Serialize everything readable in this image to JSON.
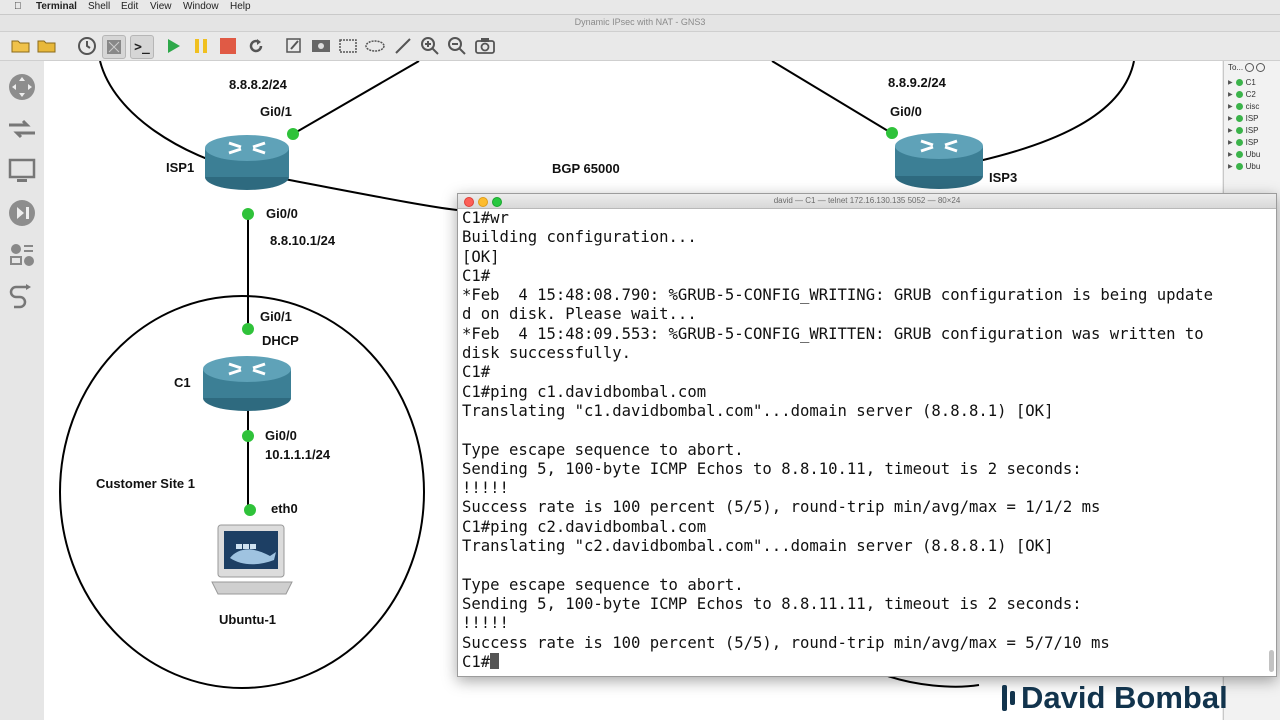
{
  "menubar": {
    "items": [
      "Terminal",
      "Shell",
      "Edit",
      "View",
      "Window",
      "Help"
    ]
  },
  "window": {
    "title": "Dynamic IPsec with NAT - GNS3"
  },
  "toolbar": {
    "icons": [
      "open-folder-icon",
      "folder-icon",
      "clock-icon",
      "snapshot-icon",
      "console-icon",
      "play-icon",
      "pause-icon",
      "stop-icon",
      "reload-icon",
      "note-icon",
      "image-icon",
      "rectangle-icon",
      "ellipse-icon",
      "line-icon",
      "zoom-in-icon",
      "zoom-out-icon",
      "camera-icon"
    ]
  },
  "topology": {
    "labels": {
      "isp1_top_ip": "8.8.8.2/24",
      "isp1_gi01": "Gi0/1",
      "isp1_name": "ISP1",
      "isp1_gi00": "Gi0/0",
      "isp1_link_ip": "8.8.10.1/24",
      "bgp": "BGP 65000",
      "isp3_top_ip": "8.8.9.2/24",
      "isp3_gi00": "Gi0/0",
      "isp3_name": "ISP3",
      "c1_gi01": "Gi0/1",
      "c1_dhcp": "DHCP",
      "c1_name": "C1",
      "c1_gi00": "Gi0/0",
      "c1_lan_ip": "10.1.1.1/24",
      "site": "Customer Site 1",
      "eth0": "eth0",
      "ubuntu": "Ubuntu-1"
    }
  },
  "right_panel": {
    "header": "To...",
    "nodes": [
      "C1",
      "C2",
      "cisc",
      "ISP",
      "ISP",
      "ISP",
      "Ubu",
      "Ubu"
    ]
  },
  "terminal": {
    "title": "david — C1 — telnet 172.16.130.135 5052 — 80×24",
    "lines": [
      "C1#wr",
      "Building configuration...",
      "[OK]",
      "C1#",
      "*Feb  4 15:48:08.790: %GRUB-5-CONFIG_WRITING: GRUB configuration is being update",
      "d on disk. Please wait...",
      "*Feb  4 15:48:09.553: %GRUB-5-CONFIG_WRITTEN: GRUB configuration was written to",
      "disk successfully.",
      "C1#",
      "C1#ping c1.davidbombal.com",
      "Translating \"c1.davidbombal.com\"...domain server (8.8.8.1) [OK]",
      "",
      "Type escape sequence to abort.",
      "Sending 5, 100-byte ICMP Echos to 8.8.10.11, timeout is 2 seconds:",
      "!!!!!",
      "Success rate is 100 percent (5/5), round-trip min/avg/max = 1/1/2 ms",
      "C1#ping c2.davidbombal.com",
      "Translating \"c2.davidbombal.com\"...domain server (8.8.8.1) [OK]",
      "",
      "Type escape sequence to abort.",
      "Sending 5, 100-byte ICMP Echos to 8.8.11.11, timeout is 2 seconds:",
      "!!!!!",
      "Success rate is 100 percent (5/5), round-trip min/avg/max = 5/7/10 ms"
    ],
    "prompt": "C1#"
  },
  "brand": {
    "text": "David Bombal"
  },
  "colors": {
    "router_body": "#3c7f95",
    "link_dot": "#2fc23a",
    "brand": "#12344d"
  }
}
